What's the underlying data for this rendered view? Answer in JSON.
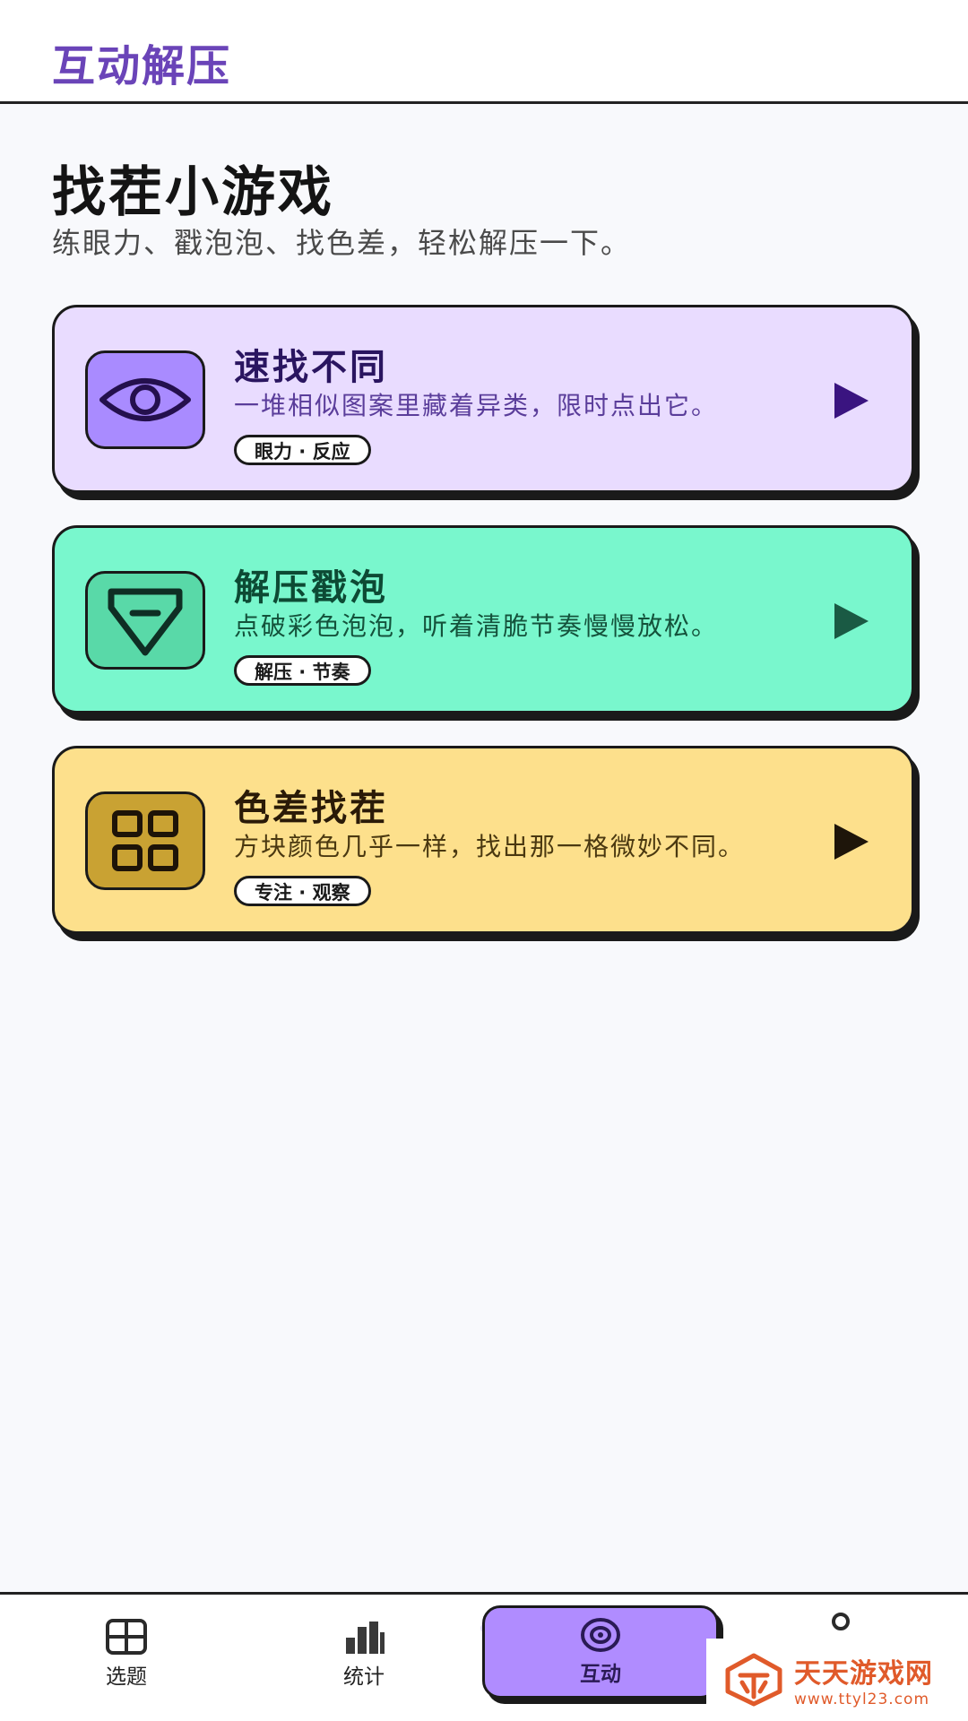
{
  "header": {
    "app_title": "互动解压"
  },
  "page": {
    "title": "找茬小游戏",
    "subtitle": "练眼力、戳泡泡、找色差，轻松解压一下。"
  },
  "cards": [
    {
      "title": "速找不同",
      "description": "一堆相似图案里藏着异类，限时点出它。",
      "tag": "眼力 · 反应",
      "icon": "eye-icon",
      "bg": "#e9dcff",
      "icon_bg": "#a98bff",
      "title_color": "#2a1560",
      "desc_color": "#5a3d9a",
      "play_color": "#3a1480"
    },
    {
      "title": "解压戳泡",
      "description": "点破彩色泡泡，听着清脆节奏慢慢放松。",
      "tag": "解压 · 节奏",
      "icon": "diamond-icon",
      "bg": "#79f7cd",
      "icon_bg": "#59d9a8",
      "title_color": "#0d4a34",
      "desc_color": "#14523b",
      "play_color": "#1a5a44"
    },
    {
      "title": "色差找茬",
      "description": "方块颜色几乎一样，找出那一格微妙不同。",
      "tag": "专注 · 观察",
      "icon": "grid-icon",
      "bg": "#fde08c",
      "icon_bg": "#c9a233",
      "title_color": "#2a1a08",
      "desc_color": "#4a3810",
      "play_color": "#1e150a"
    }
  ],
  "bottom_nav": {
    "items": [
      {
        "label": "选题",
        "icon": "grid-square-icon"
      },
      {
        "label": "统计",
        "icon": "bar-chart-icon"
      },
      {
        "label": "互动",
        "icon": "target-icon",
        "active": true
      },
      {
        "label": "",
        "icon": "user-icon"
      }
    ]
  },
  "watermark": {
    "name": "天天游戏网",
    "url": "www.ttyl23.com"
  }
}
